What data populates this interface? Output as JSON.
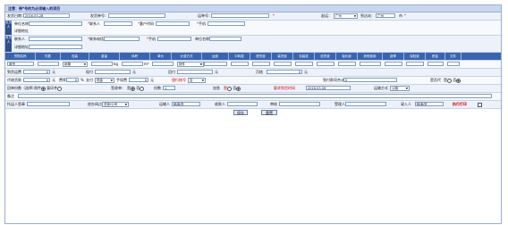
{
  "notice": "注意：带*号的为必须输入的项目",
  "row1": {
    "date_label": "发货日期：",
    "date_value": "2016-03-28",
    "order_label": "发货单号：",
    "bill_label": "运单号：",
    "origin_label": "起运：",
    "origin_value": "广州",
    "arrival_label": "到达站：",
    "arrival_value": "广州",
    "city_label": "市"
  },
  "consignor": {
    "side": "发货人",
    "unit_label": "单位名称",
    "contact_label": "联系人",
    "customer_label": "客户代码",
    "phone_label": "手机",
    "detail_label": "详细地址"
  },
  "consignee": {
    "side": "收货人",
    "contact_label": "联系人",
    "addr_label": "联系电话",
    "mobile_label": "手机",
    "unit_label": "单位名称",
    "detail_label": "详细地址"
  },
  "cargo_headers": [
    "货物名称",
    "件数",
    "包装",
    "重量",
    "体积",
    "单价",
    "计费方式",
    "运费",
    "中转费",
    "提货费",
    "装货费",
    "包装费",
    "送货费",
    "保价费",
    "其他费用",
    "费率",
    "保险费",
    "税金",
    "文件"
  ],
  "cargo_row": {
    "name_value": "普货",
    "pack_value": "纸箱",
    "weight_unit": "kg",
    "vol_unit": "m³",
    "charge_value": "按件"
  },
  "fees_row": {
    "freight_label": "到货运费",
    "freight_value": "0",
    "freight_unit": "元",
    "collect_label": "现付",
    "collect_unit": "元",
    "return_label": "回付",
    "return_unit": "元",
    "monthly_label": "月结",
    "monthly_value": "0",
    "monthly_unit": "元"
  },
  "agent_row": {
    "agent_label": "代收货款",
    "agent_value": "0",
    "agent_unit": "元",
    "rate_label": "费率",
    "rate_value": "0",
    "rate_unit": "%",
    "method_label": "支付",
    "method_value": "现金",
    "fee_label": "手续费",
    "fee_value": "0",
    "fee_unit": "元",
    "bank_label": "银行帐号",
    "bank_value": "否",
    "total_label": "到付款项合计",
    "total_value": "0",
    "insure_label": "是否代",
    "yes": "是",
    "no": "否"
  },
  "sign_row": {
    "receipt_label": "回单份数（选择）",
    "receipt_yes": "原件",
    "receipt_no": "复印件",
    "copies_label": "签收单：",
    "copies_yes": "是",
    "copies_no": "否",
    "copies_count_label": "份数",
    "copies_count": "1",
    "urgent_label": "加急",
    "urgent_yes": "是",
    "urgent_no": "否",
    "delivery_time_label": "要求到货时间",
    "delivery_time_value": "2016-03-28",
    "transport_label": "运输方式",
    "transport_value": "公路"
  },
  "remark_label": "备注",
  "footer_row": {
    "staff_label": "托运人签章",
    "handler_label": "经办网点",
    "handler_value": "总部/公司",
    "driver_label": "运输人",
    "driver_value": "韩涛/张",
    "payee_label": "收款人",
    "keeper_label": "审核",
    "clerk_label": "受理人",
    "inputter_label": "录入人",
    "inputter_value": "韩涛/张",
    "print_label": "执行打印"
  },
  "buttons": {
    "save": "保存",
    "reset": "重置"
  }
}
